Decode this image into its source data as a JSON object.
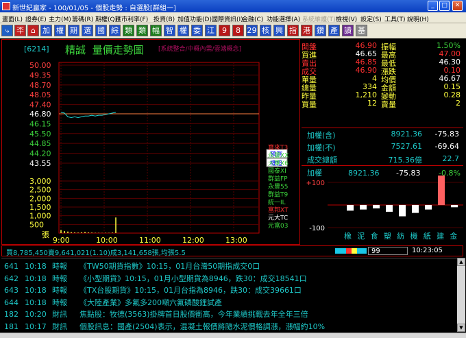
{
  "window": {
    "title": "新世紀贏家 - 100/01/05 - 個股走勢 : 自選股[群組一]"
  },
  "menu": [
    "畫面(L)",
    "證券(E)",
    "主力(M)",
    "籌碼(R)",
    "期權(Q)",
    "匯市利率(F)",
    "投資(B)",
    "加值功能(D)",
    "國際資訊(I)",
    "金融(C)",
    "功能選擇(A)",
    "系統維護(T)",
    "檢視(V)",
    "設定(S)",
    "工具(T)",
    "說明(H)"
  ],
  "toolbar": [
    "分",
    "K",
    "加",
    "權",
    "期",
    "選",
    "國",
    "綜",
    "類",
    "類",
    "幅",
    "智",
    "權",
    "委",
    "江",
    "9",
    "8",
    "29",
    "核",
    "興",
    "指",
    "港",
    "鑽",
    "產",
    "讀",
    "基"
  ],
  "chart": {
    "code": "[6214]",
    "name": "精誠",
    "title": "量價走勢圖",
    "subtitle": "[系統整合/中概內需/雲端概念]",
    "price_ticks": [
      "50.00",
      "49.35",
      "48.70",
      "48.05",
      "47.40",
      "46.80",
      "46.15",
      "45.50",
      "44.85",
      "44.20",
      "43.55"
    ],
    "volume_ticks": [
      "3,000",
      "2,500",
      "2,000",
      "1,500",
      "1,000",
      "500",
      "張"
    ],
    "time_ticks": [
      "9:00",
      "10:00",
      "11:00",
      "12:00",
      "13:00"
    ],
    "buttons": [
      "預測",
      "權證"
    ],
    "brokers": [
      "寶來T3",
      "永豐XX",
      "大華X6",
      "國泰XI",
      "群益FP",
      "永豐55",
      "群益T9",
      "統一IL",
      "富邦XT",
      "元大TC",
      "元富03"
    ]
  },
  "chart_data": {
    "type": "line",
    "title": "量價走勢圖",
    "xlabel": "",
    "ylabel": "",
    "ylim": [
      43.55,
      50.0
    ],
    "x": [
      "9:00",
      "9:05",
      "9:10",
      "9:15",
      "9:20",
      "9:25",
      "9:30",
      "9:35",
      "9:40",
      "9:45",
      "9:50",
      "9:55",
      "10:00",
      "10:05",
      "10:10",
      "10:15",
      "10:18"
    ],
    "series": [
      {
        "values": [
          46.9,
          46.85,
          46.6,
          46.55,
          46.6,
          46.55,
          46.6,
          46.65,
          46.65,
          46.7,
          46.65,
          46.7,
          46.7,
          46.75,
          46.8,
          46.85,
          46.9
        ]
      }
    ],
    "volume": [
      180,
      120,
      90,
      60,
      40,
      30,
      50,
      70,
      40,
      30,
      20,
      15,
      10,
      20,
      15,
      30,
      900
    ],
    "reference": 46.8
  },
  "quote": {
    "rows": [
      {
        "l1": "開盤",
        "v1": "46.90",
        "l2": "振幅",
        "v2": "1.50%",
        "c1": "#ff3030",
        "c2": "#3cd23c"
      },
      {
        "l1": "買進",
        "v1": "46.65",
        "l2": "最高",
        "v2": "47.00",
        "c1": "#ffffff",
        "c2": "#ff3030"
      },
      {
        "l1": "賣出",
        "v1": "46.85",
        "l2": "最低",
        "v2": "46.30",
        "c1": "#ff3030",
        "c2": "#ffffff"
      },
      {
        "l1": "成交",
        "v1": "46.90",
        "l2": "漲跌",
        "v2": "0.10",
        "c1": "#ff3030",
        "c2": "#ff3030"
      },
      {
        "l1": "單量",
        "v1": "4",
        "l2": "均價",
        "v2": "46.67",
        "c1": "#ffff40",
        "c2": "#ffffff"
      },
      {
        "l1": "總量",
        "v1": "334",
        "l2": "金額",
        "v2": "0.15",
        "c1": "#ffff40",
        "c2": "#ffff40"
      },
      {
        "l1": "昨量",
        "v1": "1,210",
        "l2": "變動",
        "v2": "0.28",
        "c1": "#ffff40",
        "c2": "#ffff40"
      },
      {
        "l1": "買量",
        "v1": "12",
        "l2": "賣量",
        "v2": "2",
        "c1": "#ffff40",
        "c2": "#ffff40"
      }
    ]
  },
  "index": {
    "rows": [
      {
        "l": "加權(含)",
        "m": "8921.36",
        "r": "-75.83"
      },
      {
        "l": "加權(不)",
        "m": "7527.61",
        "r": "-69.64"
      },
      {
        "l": "成交總額",
        "m": "715.36億",
        "r": "22.7"
      }
    ]
  },
  "sector": {
    "label": "加權",
    "value": "8921.36",
    "change": "-75.83",
    "pct": "-0.8%",
    "ticks": [
      "+200",
      "+100",
      "-100",
      "-200"
    ],
    "categories": [
      "橡",
      "泥",
      "食",
      "塑",
      "紡",
      "機",
      "紙",
      "建",
      "金"
    ],
    "values": [
      -25,
      -20,
      -15,
      -30,
      -50,
      -35,
      -20,
      130,
      -10
    ]
  },
  "info": {
    "text": "買8,785,450賣9,641,021(1.10)成3,141,658張,均張5.5",
    "page": "99",
    "time": "10:23:05"
  },
  "news": [
    {
      "n": "641",
      "t": "10:18",
      "c": "時報",
      "s": "《TW50期貨指數》10:15，01月台灣50期指成交0口"
    },
    {
      "n": "642",
      "t": "10:18",
      "c": "時報",
      "s": "《小型期貨》10:15，01月小型期貨為8946，跌30：成交18541口"
    },
    {
      "n": "643",
      "t": "10:18",
      "c": "時報",
      "s": "《TX台股期貨》10:15，01月台指為8946，跌30：成交39661口"
    },
    {
      "n": "644",
      "t": "10:18",
      "c": "時報",
      "s": "《大陸產業》多氟多200噸六氟磷酸鋰試產"
    },
    {
      "n": "182",
      "t": "10:20",
      "c": "財訊",
      "s": "焦點股：牧德(3563)掛牌首日股價衝高，今年業績挑戰去年全年三倍"
    },
    {
      "n": "181",
      "t": "10:17",
      "c": "財訊",
      "s": "個股訊息：國產(2504)表示，混凝土報價將隨水泥價格調漲，漲幅約10%"
    }
  ]
}
